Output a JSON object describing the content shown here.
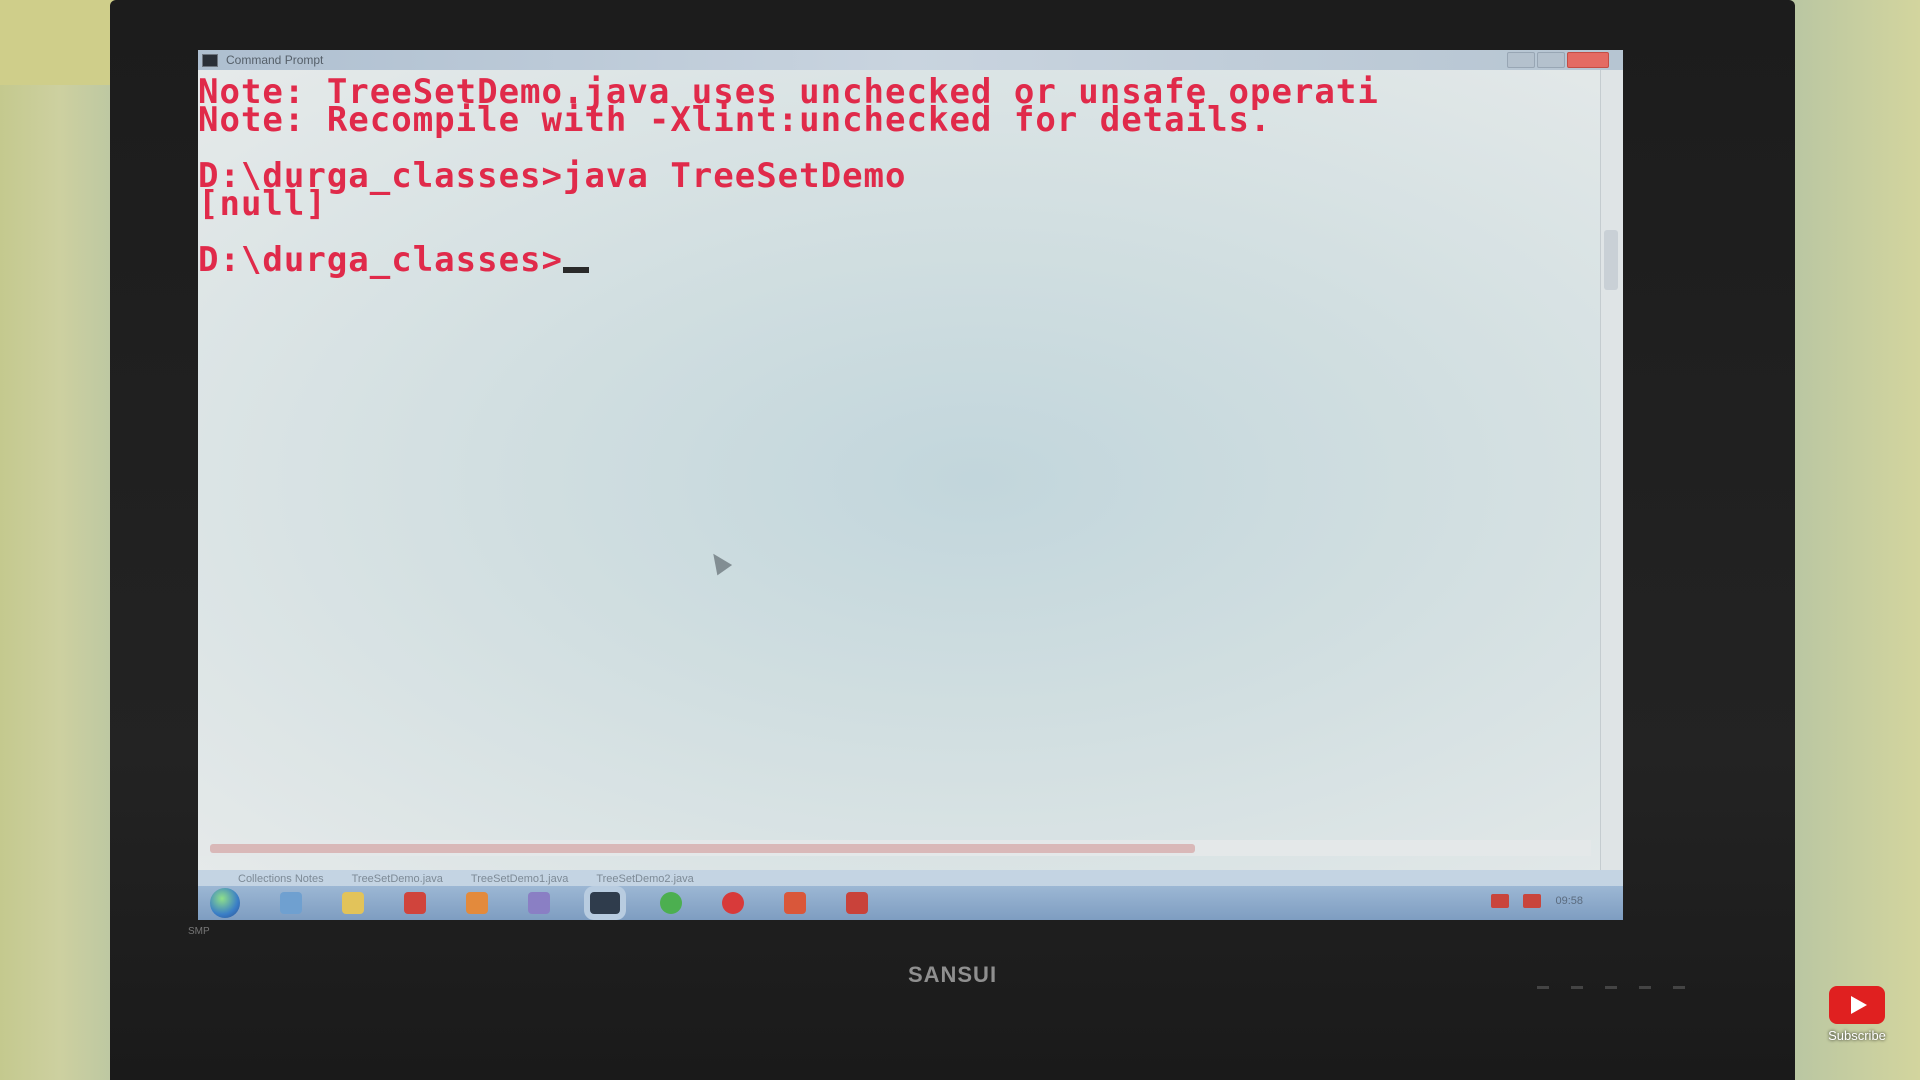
{
  "window": {
    "title": "Command Prompt"
  },
  "console": {
    "lines": [
      "Note: TreeSetDemo.java uses unchecked or unsafe operati",
      "Note: Recompile with -Xlint:unchecked for details.",
      "",
      "D:\\durga_classes>java TreeSetDemo",
      "[null]",
      "",
      "D:\\durga_classes>"
    ]
  },
  "taskbar": {
    "tabs": [
      "Collections Notes",
      "TreeSetDemo.java",
      "TreeSetDemo1.java",
      "TreeSetDemo2.java"
    ],
    "icons": [
      "start-orb",
      "pen-icon",
      "folder-icon",
      "media-icon",
      "firefox-icon",
      "network-icon",
      "cmd-icon",
      "chrome-icon",
      "opera-icon",
      "paint-icon",
      "pdf-icon"
    ],
    "clock": "09:58"
  },
  "monitor": {
    "brand": "SANSUI",
    "model": "SMP"
  },
  "overlay": {
    "subscribe_label": "Subscribe"
  }
}
